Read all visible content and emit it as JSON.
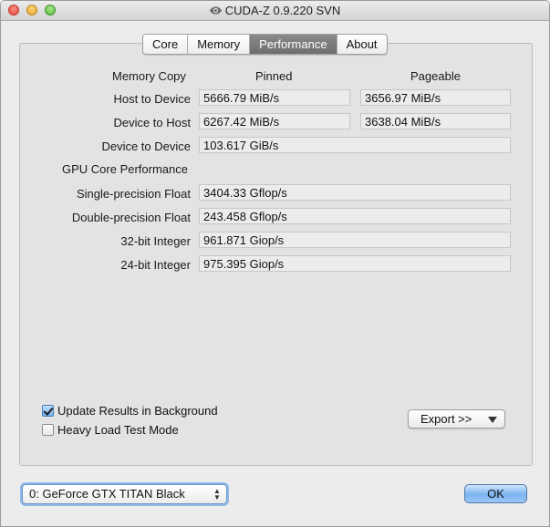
{
  "window": {
    "title": "CUDA-Z 0.9.220 SVN"
  },
  "tabs": [
    {
      "label": "Core",
      "active": false
    },
    {
      "label": "Memory",
      "active": false
    },
    {
      "label": "Performance",
      "active": true
    },
    {
      "label": "About",
      "active": false
    }
  ],
  "memory_copy": {
    "section_label": "Memory Copy",
    "col_pinned": "Pinned",
    "col_pageable": "Pageable",
    "rows": [
      {
        "label": "Host to Device",
        "pinned": "5666.79 MiB/s",
        "pageable": "3656.97 MiB/s"
      },
      {
        "label": "Device to Host",
        "pinned": "6267.42 MiB/s",
        "pageable": "3638.04 MiB/s"
      },
      {
        "label": "Device to Device",
        "pinned": "103.617 GiB/s"
      }
    ]
  },
  "gpu_core": {
    "section_label": "GPU Core Performance",
    "rows": [
      {
        "label": "Single-precision Float",
        "value": "3404.33 Gflop/s"
      },
      {
        "label": "Double-precision Float",
        "value": "243.458 Gflop/s"
      },
      {
        "label": "32-bit Integer",
        "value": "961.871 Giop/s"
      },
      {
        "label": "24-bit Integer",
        "value": "975.395 Giop/s"
      }
    ]
  },
  "options": {
    "update_background": {
      "label": "Update Results in Background",
      "checked": true
    },
    "heavy_load": {
      "label": "Heavy Load Test Mode",
      "checked": false
    }
  },
  "export_button": {
    "label": "Export >>",
    "icon": "triangle-down-icon"
  },
  "device_select": {
    "selected": "0: GeForce GTX TITAN Black"
  },
  "ok_button": {
    "label": "OK"
  },
  "colors": {
    "active_tab": "#7a7a7a",
    "ok_button": "#7bb3ef",
    "select_focus": "#8eb8e8"
  }
}
